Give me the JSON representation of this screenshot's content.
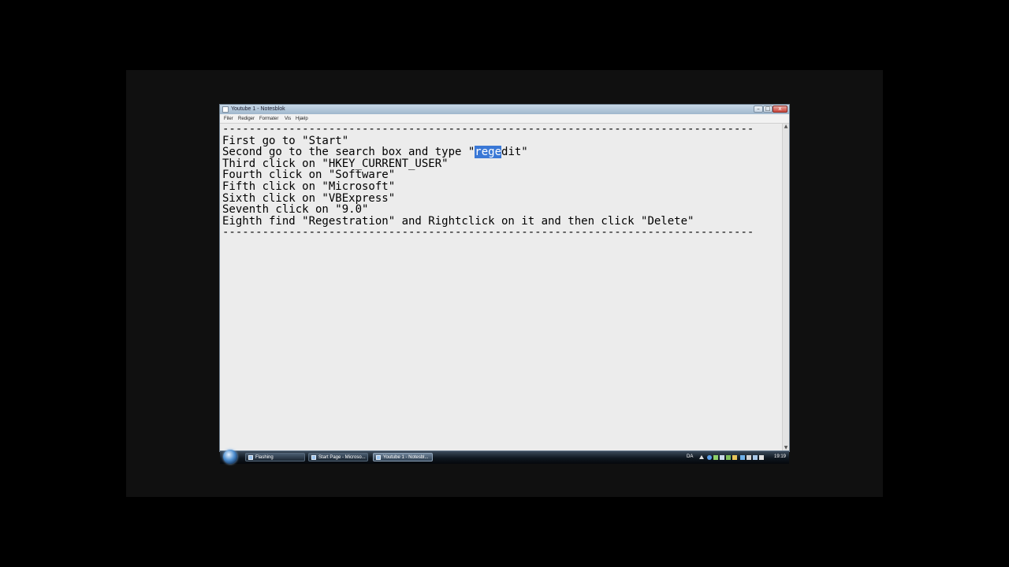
{
  "window": {
    "title": "Youtube 1 - Notesblok",
    "controls": {
      "minimize": "–",
      "maximize": "□",
      "close": "x"
    }
  },
  "menu": [
    "Filer",
    "Rediger",
    "Formater",
    "Vis",
    "Hjælp"
  ],
  "document": {
    "divider": "--------------------------------------------------------------------------------",
    "lines": [
      "First go to \"Start\"",
      "Second go to the search box and type \"regedit\"",
      "Third click on \"HKEY_CURRENT_USER\"",
      "Fourth click on \"Software\"",
      "Fifth click on \"Microsoft\"",
      "Sixth click on \"VBExpress\"",
      "Seventh click on \"9.0\"",
      "Eighth find \"Regestration\" and Rightclick on it and then click \"Delete\""
    ],
    "selection": {
      "line": 1,
      "text": "rege",
      "before": "Second go to the search box and type \"",
      "after": "dit\""
    }
  },
  "taskbar": {
    "tasks": [
      {
        "label": "Flashing",
        "icon": "app-icon",
        "active": false
      },
      {
        "label": "Start Page - Microso...",
        "icon": "app-icon",
        "active": false
      },
      {
        "label": "Youtube 1 - Notesbl...",
        "icon": "notepad-icon",
        "active": true
      }
    ],
    "tray": {
      "language": "DA",
      "clock": "19:19"
    }
  },
  "colors": {
    "selection": "#3a78d6",
    "editor_bg": "#ececec",
    "taskbar": "#0f1720"
  }
}
